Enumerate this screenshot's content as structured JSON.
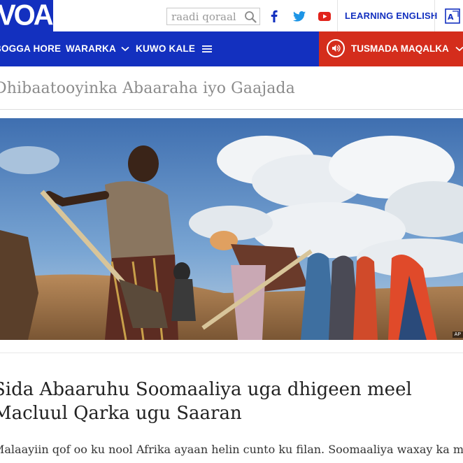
{
  "header": {
    "logo_text": "VOA",
    "search_placeholder": "raadi qoraal",
    "learning_label": "LEARNING ENGLISH",
    "social": [
      "facebook-icon",
      "twitter-icon",
      "youtube-icon"
    ]
  },
  "nav": {
    "items": [
      {
        "label": "BOGGA HORE"
      },
      {
        "label": "WARARKA"
      },
      {
        "label": "KUWO KALE"
      }
    ],
    "listen_label": "TUSMADA MAQALKA"
  },
  "section": {
    "title": "Dhibaatooyinka Abaaraha iyo Gaajada"
  },
  "article": {
    "image_credit": "AP",
    "headline": "Sida Abaaruhu Soomaaliya uga dhigeen meel Macluul Qarka ugu Saaran",
    "body": "Malaayiin qof oo ku nool Afrika ayaan helin cunto ku filan. Soomaaliya waxay ka mid"
  },
  "colors": {
    "brand_blue": "#1330bf",
    "listen_red": "#d42d1c"
  }
}
